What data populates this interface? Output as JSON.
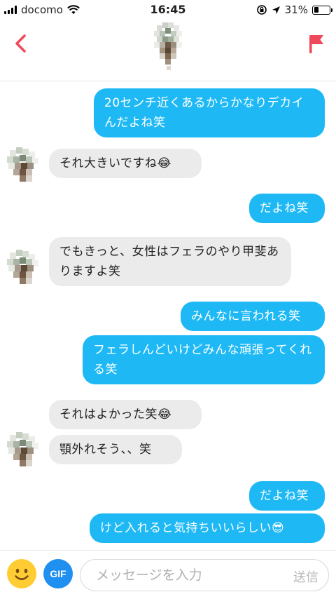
{
  "status_bar": {
    "carrier": "docomo",
    "time": "16:45",
    "battery_percent": "31%",
    "battery_level": 0.31,
    "icons": [
      "signal-icon",
      "wifi-icon",
      "rotation-lock-icon",
      "location-arrow-icon",
      "battery-icon"
    ]
  },
  "header": {
    "back_icon": "chevron-left-icon",
    "report_icon": "flag-icon",
    "accent": "#ef4a5c"
  },
  "messages": [
    {
      "dir": "out",
      "text": "20センチ近くあるからかなりデカイんだよね笑"
    },
    {
      "dir": "in",
      "text": "それ大きいですね😂"
    },
    {
      "dir": "out",
      "text": "だよね笑"
    },
    {
      "dir": "in",
      "text": "でもきっと、女性はフェラのやり甲斐ありますよ笑"
    },
    {
      "dir": "out",
      "text": "みんなに言われる笑"
    },
    {
      "dir": "out",
      "text": "フェラしんどいけどみんな頑張ってくれる笑"
    },
    {
      "dir": "in",
      "text": "それはよかった笑😂"
    },
    {
      "dir": "in",
      "text": "顎外れそう、、笑"
    },
    {
      "dir": "out",
      "text": "だよね笑"
    },
    {
      "dir": "out",
      "text": "けど入れると気持ちいいらしい😎"
    }
  ],
  "input_bar": {
    "gif_label": "GIF",
    "placeholder": "メッセージを入力",
    "send_label": "送信",
    "emoji_icon": "smiley-icon"
  },
  "colors": {
    "outgoing_bubble": "#1eb9f5",
    "incoming_bubble": "#ebebeb",
    "gif_button": "#1f8ff0"
  }
}
